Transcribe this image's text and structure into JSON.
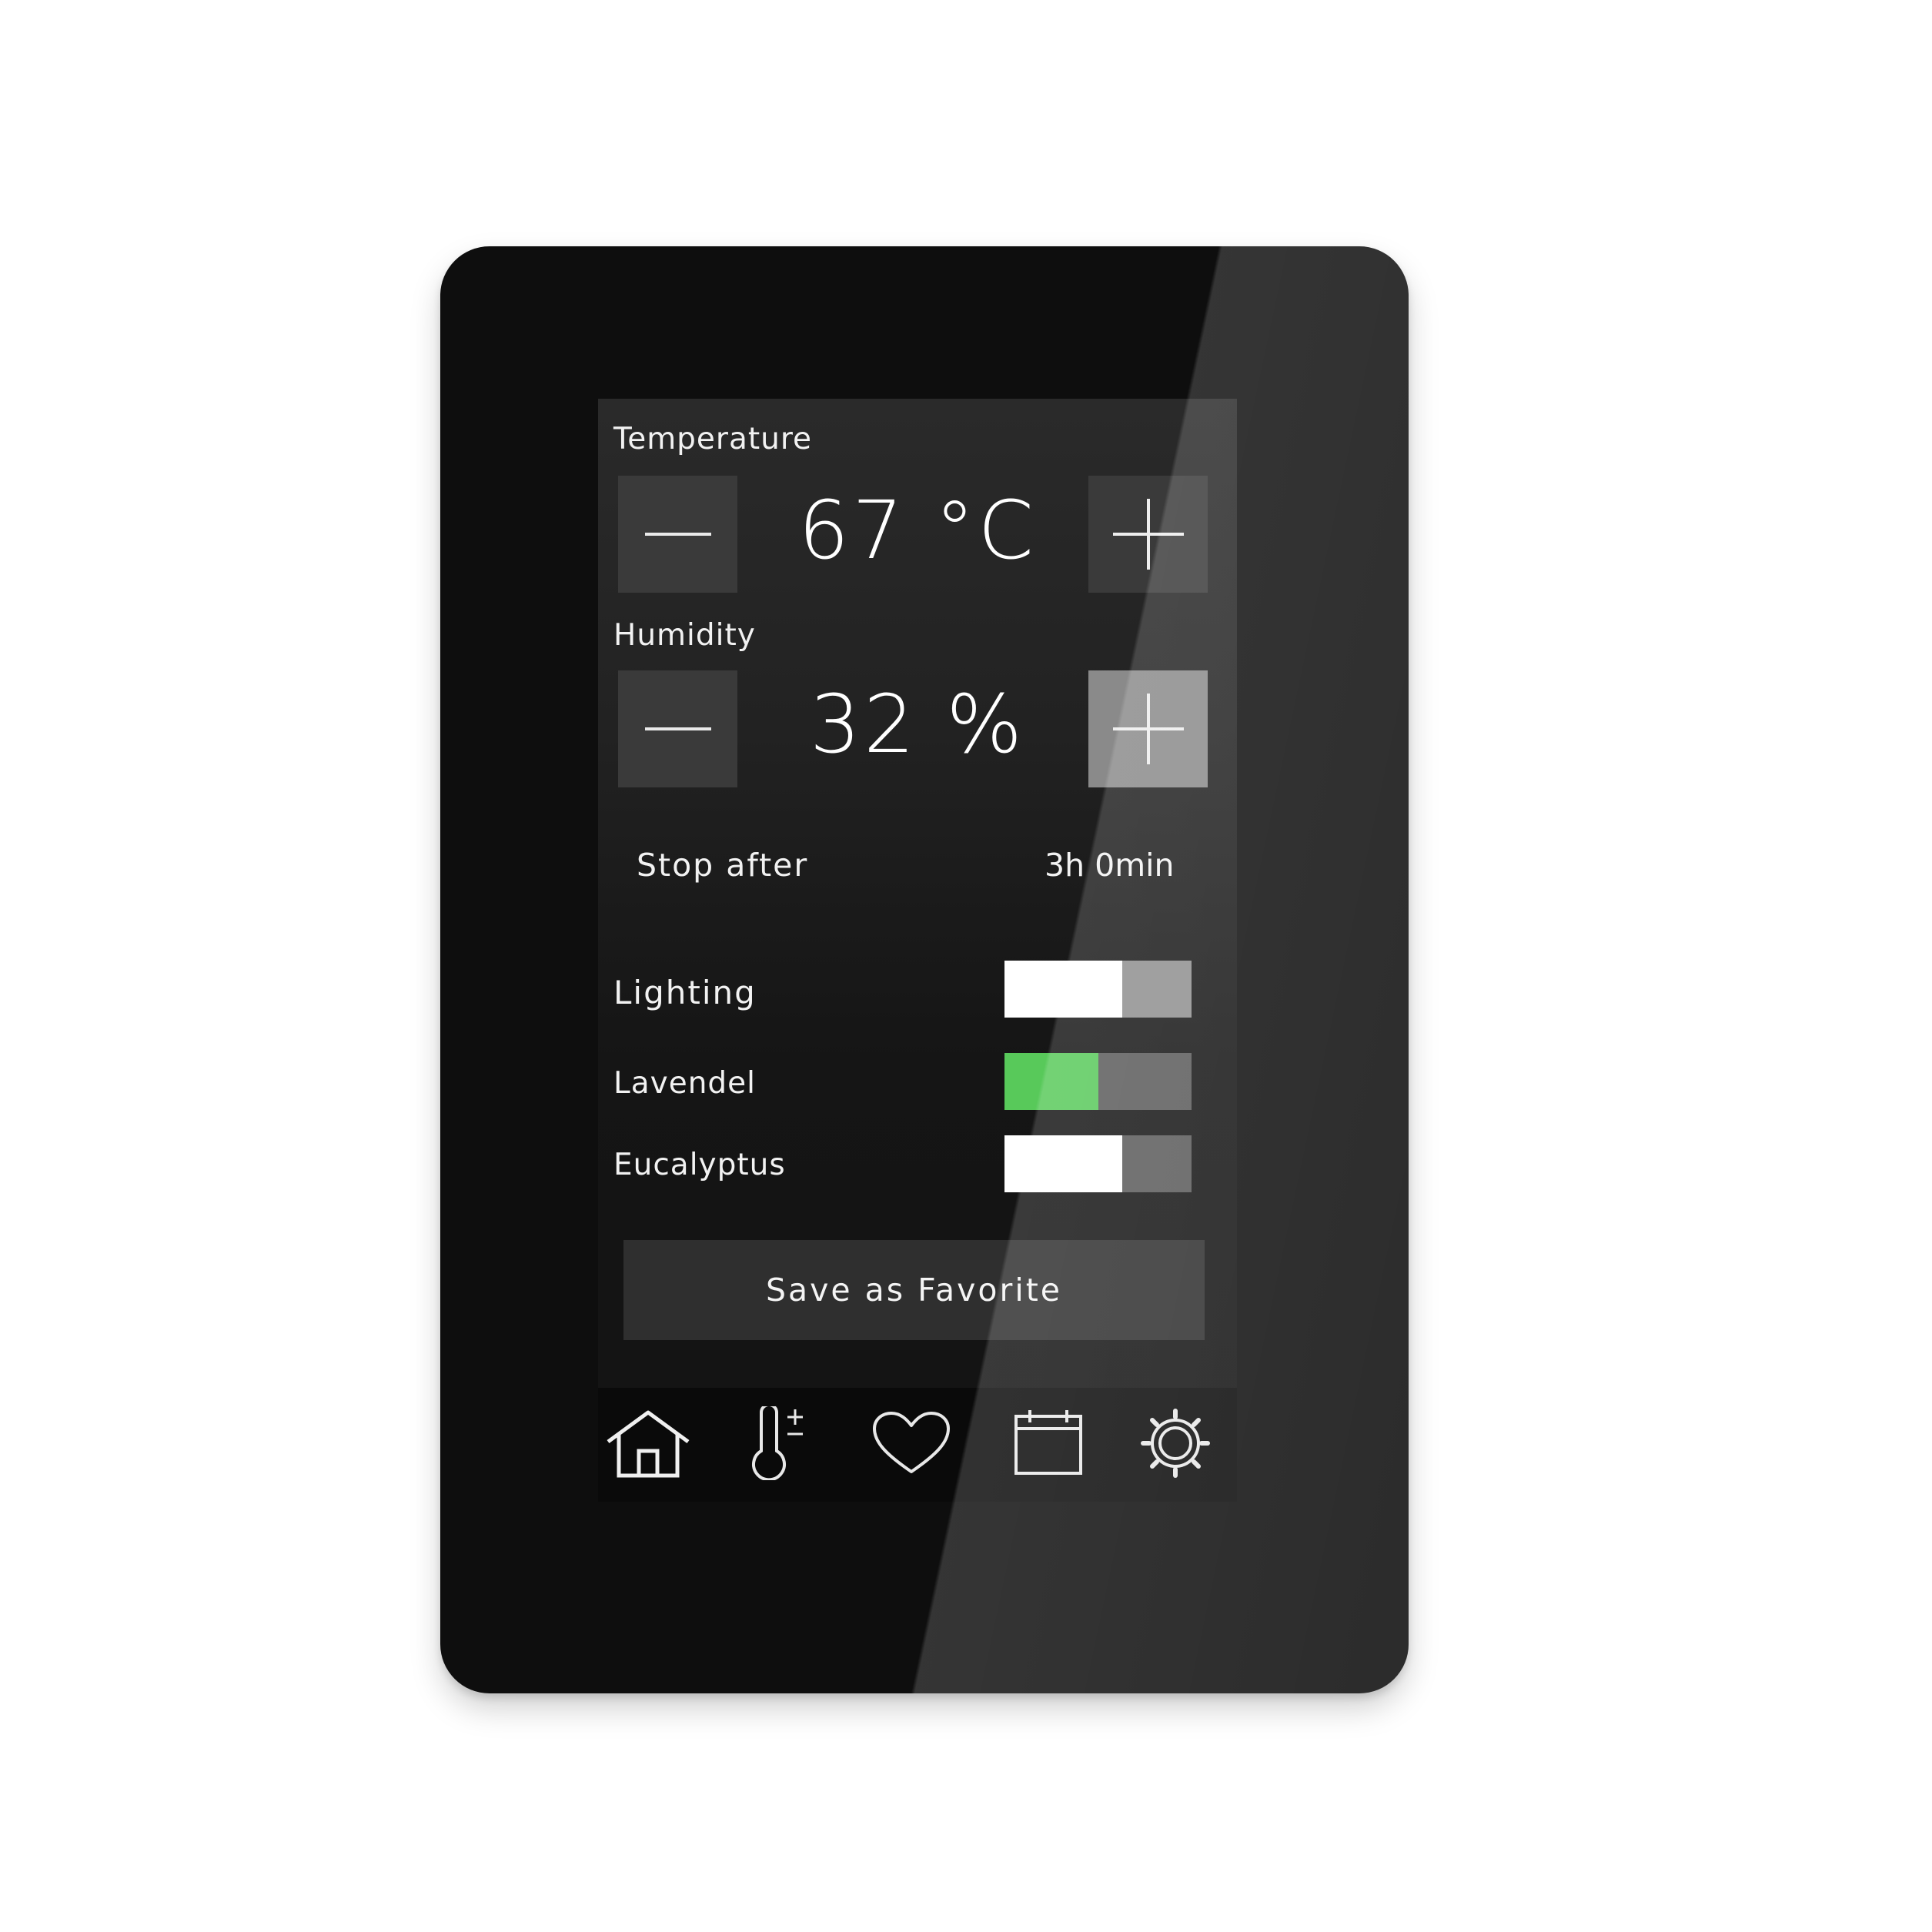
{
  "temperature": {
    "label": "Temperature",
    "value": "67 °C"
  },
  "humidity": {
    "label": "Humidity",
    "value": "32 %"
  },
  "timer": {
    "label": "Stop after",
    "value": "3h 0min"
  },
  "toggles": {
    "lighting": {
      "label": "Lighting",
      "state": "on"
    },
    "lavendel": {
      "label": "Lavendel",
      "state": "on",
      "color": "#58c95a"
    },
    "eucalyptus": {
      "label": "Eucalyptus",
      "state": "on"
    }
  },
  "save_button": {
    "label": "Save as Favorite"
  },
  "nav": {
    "items": [
      {
        "icon": "home-icon"
      },
      {
        "icon": "thermometer-icon"
      },
      {
        "icon": "heart-icon"
      },
      {
        "icon": "calendar-icon"
      },
      {
        "icon": "gear-icon"
      }
    ]
  }
}
